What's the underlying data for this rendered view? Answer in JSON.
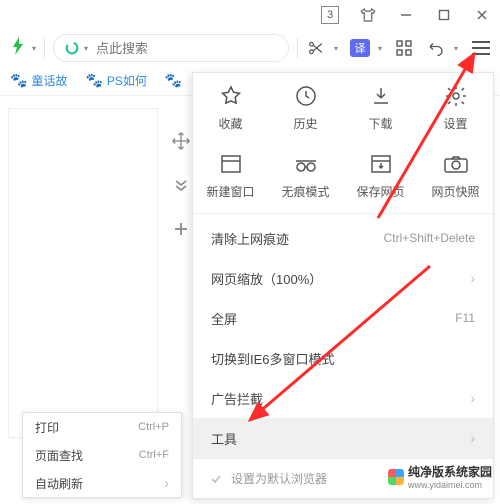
{
  "titlebar": {
    "tab_count": "3"
  },
  "toolbar": {
    "search_placeholder": "点此搜索",
    "translate_label": "译"
  },
  "tabs": [
    {
      "label": "童话故"
    },
    {
      "label": "PS如何"
    }
  ],
  "menu": {
    "grid1": [
      {
        "icon": "star-icon",
        "label": "收藏"
      },
      {
        "icon": "history-icon",
        "label": "历史"
      },
      {
        "icon": "download-icon",
        "label": "下载"
      },
      {
        "icon": "settings-icon",
        "label": "设置"
      }
    ],
    "grid2": [
      {
        "icon": "new-window-icon",
        "label": "新建窗口"
      },
      {
        "icon": "incognito-icon",
        "label": "无痕模式"
      },
      {
        "icon": "save-page-icon",
        "label": "保存网页"
      },
      {
        "icon": "snapshot-icon",
        "label": "网页快照"
      }
    ],
    "rows": [
      {
        "label": "清除上网痕迹",
        "hint": "Ctrl+Shift+Delete",
        "chevron": false
      },
      {
        "label": "网页缩放（100%）",
        "hint": "",
        "chevron": true
      },
      {
        "label": "全屏",
        "hint": "F11",
        "chevron": false
      },
      {
        "label": "切换到IE6多窗口模式",
        "hint": "",
        "chevron": false
      },
      {
        "label": "广告拦截",
        "hint": "",
        "chevron": true
      },
      {
        "label": "工具",
        "hint": "",
        "chevron": true,
        "highlight": true
      }
    ],
    "footer": "设置为默认浏览器"
  },
  "submenu": [
    {
      "label": "打印",
      "hint": "Ctrl+P"
    },
    {
      "label": "页面查找",
      "hint": "Ctrl+F"
    },
    {
      "label": "自动刷新",
      "hint": "",
      "chevron": true
    }
  ],
  "watermark": {
    "title": "纯净版系统家园",
    "sub": "www.yidaimei.com"
  }
}
